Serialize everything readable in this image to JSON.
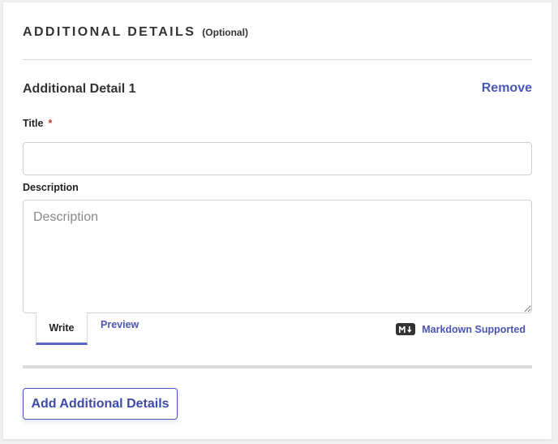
{
  "section": {
    "title": "ADDITIONAL DETAILS",
    "optional_label": "(Optional)"
  },
  "detail": {
    "heading": "Additional Detail 1",
    "remove_label": "Remove",
    "title_label": "Title",
    "required_marker": "*",
    "title_value": "",
    "description_label": "Description",
    "description_placeholder": "Description",
    "description_value": ""
  },
  "editor": {
    "tabs": [
      {
        "label": "Write",
        "active": true
      },
      {
        "label": "Preview",
        "active": false
      }
    ],
    "markdown_icon": "markdown-icon",
    "markdown_label": "Markdown Supported"
  },
  "actions": {
    "add_label": "Add Additional Details"
  },
  "colors": {
    "accent": "#4a56b5",
    "required": "#c0392b",
    "text": "#333333"
  }
}
